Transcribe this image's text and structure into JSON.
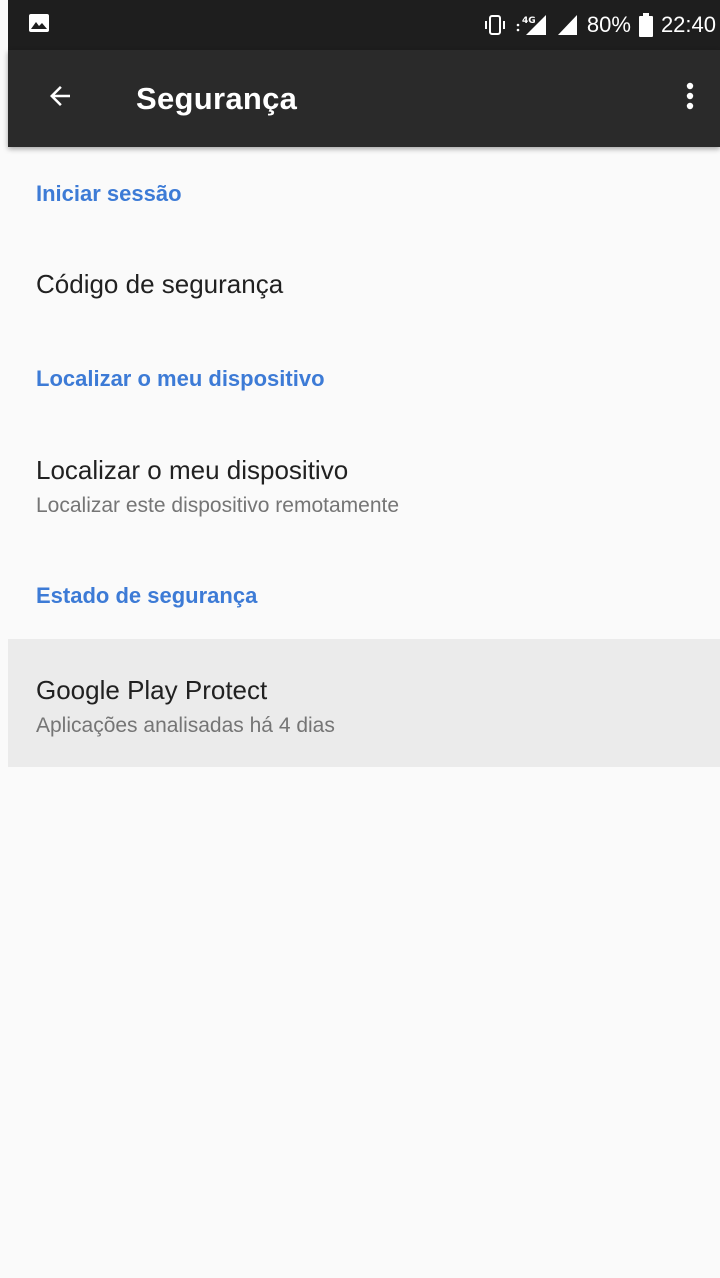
{
  "status_bar": {
    "battery_percent": "80%",
    "time": "22:40",
    "network_type": "4G",
    "icons": [
      "image-notification-icon",
      "vibrate-icon",
      "signal-4g-icon",
      "signal-icon",
      "battery-icon"
    ]
  },
  "app_bar": {
    "title": "Segurança",
    "back_icon": "arrow-back-icon",
    "more_icon": "more-vert-icon"
  },
  "sections": [
    {
      "header": "Iniciar sessão",
      "items": [
        {
          "title": "Código de segurança"
        }
      ]
    },
    {
      "header": "Localizar o meu dispositivo",
      "items": [
        {
          "title": "Localizar o meu dispositivo",
          "subtitle": "Localizar este dispositivo remotamente"
        }
      ]
    },
    {
      "header": "Estado de segurança",
      "items": [
        {
          "title": "Google Play Protect",
          "subtitle": "Aplicações analisadas há 4 dias"
        }
      ]
    }
  ],
  "colors": {
    "accent": "#3d7bd6",
    "app_bar": "#2a2a2a",
    "status_bar": "#1e1e1e",
    "background": "#fafafa",
    "highlight_row": "#ebebeb"
  }
}
